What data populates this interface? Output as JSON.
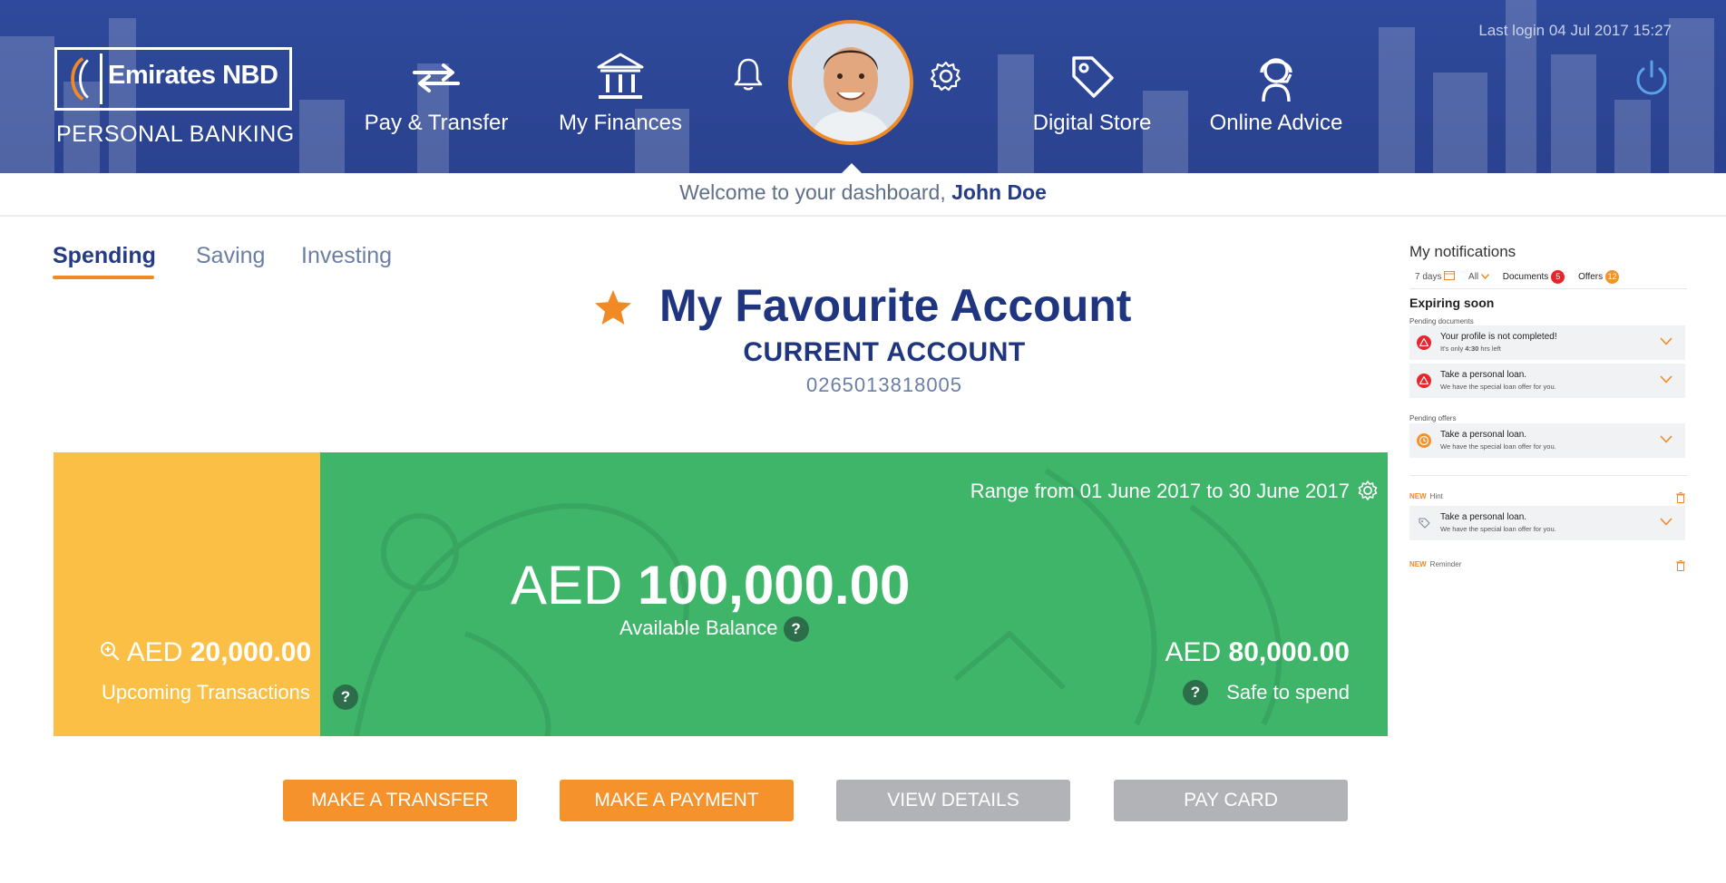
{
  "brand": {
    "name": "Emirates NBD",
    "subtitle": "PERSONAL BANKING"
  },
  "nav": {
    "items": [
      {
        "label": "Pay & Transfer",
        "icon": "transfer-arrows-icon"
      },
      {
        "label": "My Finances",
        "icon": "bank-building-icon"
      },
      {
        "label": "Digital Store",
        "icon": "price-tag-icon"
      },
      {
        "label": "Online Advice",
        "icon": "headset-agent-icon"
      }
    ]
  },
  "header": {
    "last_login": "Last login 04 Jul 2017 15:27",
    "notifications_icon": "bell-icon",
    "settings_icon": "gear-icon",
    "logout_icon": "power-icon"
  },
  "welcome": {
    "prefix": "Welcome to your dashboard,",
    "name": "John Doe"
  },
  "tabs": [
    {
      "label": "Spending",
      "active": true
    },
    {
      "label": "Saving",
      "active": false
    },
    {
      "label": "Investing",
      "active": false
    }
  ],
  "account": {
    "title": "My Favourite Account",
    "type": "CURRENT ACCOUNT",
    "number": "0265013818005"
  },
  "balance_card": {
    "range": "Range from 01 June 2017 to 30 June 2017",
    "available_currency": "AED",
    "available_amount": "100,000.00",
    "available_label": "Available Balance",
    "upcoming_currency": "AED",
    "upcoming_amount": "20,000.00",
    "upcoming_label": "Upcoming Transactions",
    "safe_currency": "AED",
    "safe_amount": "80,000.00",
    "safe_label": "Safe to spend",
    "help_glyph": "?",
    "colors": {
      "upcoming": "#fbbf45",
      "balance": "#3fb56a"
    }
  },
  "actions": [
    {
      "label": "MAKE A TRANSFER",
      "style": "primary"
    },
    {
      "label": "MAKE A PAYMENT",
      "style": "primary"
    },
    {
      "label": "VIEW DETAILS",
      "style": "secondary"
    },
    {
      "label": "PAY CARD",
      "style": "secondary"
    }
  ],
  "notifications": {
    "title": "My notifications",
    "filters": {
      "period": "7 days",
      "type": "All",
      "documents_label": "Documents",
      "documents_count": "5",
      "offers_label": "Offers",
      "offers_count": "12"
    },
    "expiring_title": "Expiring soon",
    "pending_documents_label": "Pending documents",
    "pending_offers_label": "Pending offers",
    "items": [
      {
        "title": "Your profile is not completed!",
        "sub_prefix": "It's only ",
        "sub_bold": "4:30",
        "sub_suffix": " hrs left",
        "icon": "warning-icon"
      },
      {
        "title": "Take a personal loan.",
        "sub": "We have the special loan offer for you.",
        "icon": "warning-icon"
      },
      {
        "title": "Take a personal loan.",
        "sub": "We have the special loan offer for you.",
        "icon": "clock-icon"
      },
      {
        "title": "Take a personal loan.",
        "sub": "We have the special loan offer for you.",
        "icon": "tag-icon"
      }
    ],
    "hint": {
      "badge": "NEW",
      "kind": "Hint"
    },
    "reminder": {
      "badge": "NEW",
      "kind": "Reminder"
    }
  }
}
